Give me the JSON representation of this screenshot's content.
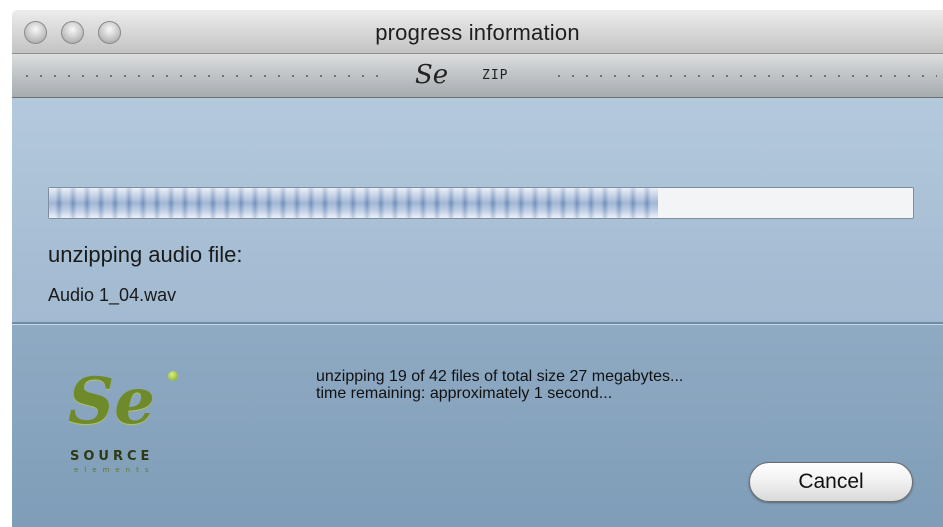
{
  "window": {
    "title": "progress information"
  },
  "toolbar": {
    "logo_text": "Se",
    "zip_label": "ZIP"
  },
  "progress": {
    "fraction": 0.705,
    "status_label": "unzipping audio file:",
    "current_file": "Audio 1_04.wav"
  },
  "details": {
    "line1": "unzipping 19 of 42 files of total size 27 megabytes...",
    "line2": "time remaining: approximately 1 second..."
  },
  "brand": {
    "logo_text": "Se",
    "name": "SOURCE",
    "tagline": "elements",
    "logo_color": "#6f8a2a"
  },
  "buttons": {
    "cancel_label": "Cancel"
  },
  "icons": {
    "traffic_lights": [
      "close-button-icon",
      "minimize-button-icon",
      "zoom-button-icon"
    ]
  }
}
